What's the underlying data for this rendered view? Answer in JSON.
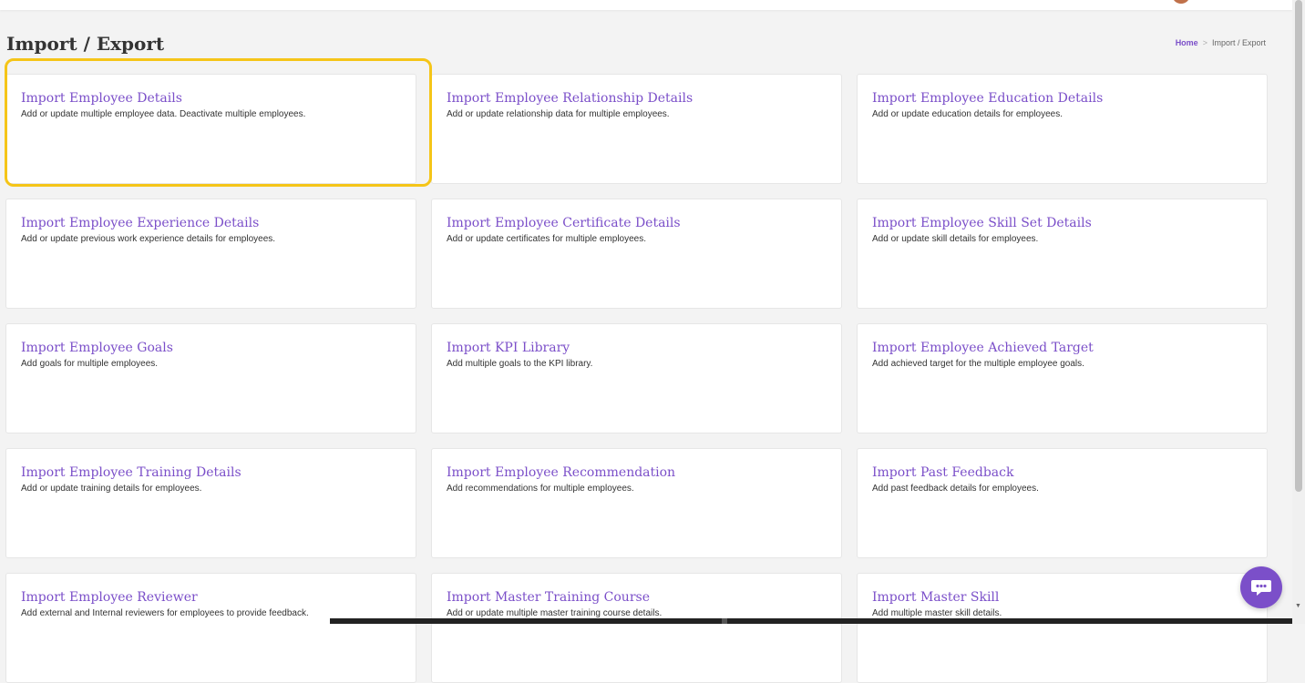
{
  "page": {
    "title": "Import / Export",
    "breadcrumb": {
      "home": "Home",
      "separator": ">",
      "current": "Import / Export"
    }
  },
  "cards": [
    {
      "title": "Import Employee Details",
      "desc": "Add or update multiple employee data. Deactivate multiple employees."
    },
    {
      "title": "Import Employee Relationship Details",
      "desc": "Add or update relationship data for multiple employees."
    },
    {
      "title": "Import Employee Education Details",
      "desc": "Add or update education details for employees."
    },
    {
      "title": "Import Employee Experience Details",
      "desc": "Add or update previous work experience details for employees."
    },
    {
      "title": "Import Employee Certificate Details",
      "desc": "Add or update certificates for multiple employees."
    },
    {
      "title": "Import Employee Skill Set Details",
      "desc": "Add or update skill details for employees."
    },
    {
      "title": "Import Employee Goals",
      "desc": "Add goals for multiple employees."
    },
    {
      "title": "Import KPI Library",
      "desc": "Add multiple goals to the KPI library."
    },
    {
      "title": "Import Employee Achieved Target",
      "desc": "Add achieved target for the multiple employee goals."
    },
    {
      "title": "Import Employee Training Details",
      "desc": "Add or update training details for employees."
    },
    {
      "title": "Import Employee Recommendation",
      "desc": "Add recommendations for multiple employees."
    },
    {
      "title": "Import Past Feedback",
      "desc": "Add past feedback details for employees."
    },
    {
      "title": "Import Employee Reviewer",
      "desc": "Add external and Internal reviewers for employees to provide feedback."
    },
    {
      "title": "Import Master Training Course",
      "desc": "Add or update multiple master training course details."
    },
    {
      "title": "Import Master Skill",
      "desc": "Add multiple master skill details."
    }
  ],
  "colors": {
    "accent": "#7b4fc9",
    "highlight": "#f5c518"
  },
  "icons": {
    "chat": "chat-support-icon",
    "scroll_down": "scroll-down-arrow-icon"
  }
}
